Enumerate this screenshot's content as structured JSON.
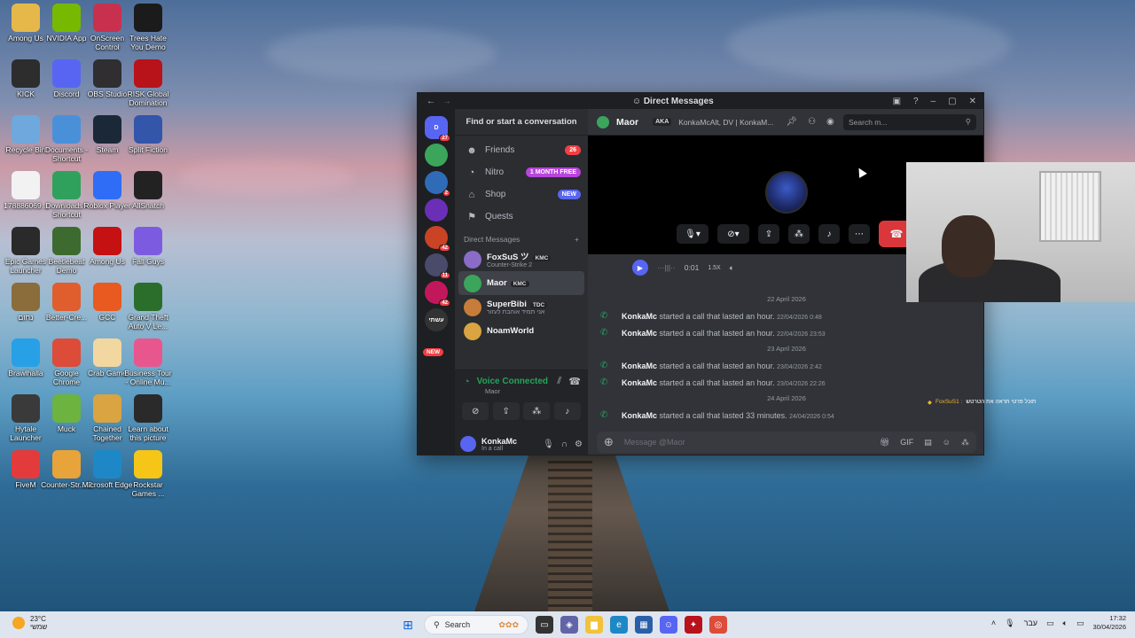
{
  "desktop": {
    "icons": [
      {
        "label": "Among Us",
        "icon": "among-us-icon",
        "color": "#e6b84a"
      },
      {
        "label": "NVIDIA App",
        "icon": "nvidia-icon",
        "color": "#76b900"
      },
      {
        "label": "OnScreen Control",
        "icon": "onscreen-control-icon",
        "color": "#c8314e"
      },
      {
        "label": "Trees Hate You Demo",
        "icon": "trees-hate-you-icon",
        "color": "#1b1b1b"
      },
      {
        "label": "KICK",
        "icon": "kick-icon",
        "color": "#2d2d2d"
      },
      {
        "label": "Discord",
        "icon": "discord-icon",
        "color": "#5865f2"
      },
      {
        "label": "OBS Studio",
        "icon": "obs-icon",
        "color": "#302e31"
      },
      {
        "label": "RISK Global Domination",
        "icon": "risk-icon",
        "color": "#b8121b"
      },
      {
        "label": "Recycle Bin",
        "icon": "recycle-bin-icon",
        "color": "#6fa8dc"
      },
      {
        "label": "Documents - Shortcut",
        "icon": "folder-icon",
        "color": "#4a90d9"
      },
      {
        "label": "Steam",
        "icon": "steam-icon",
        "color": "#1b2838"
      },
      {
        "label": "Split Fiction",
        "icon": "split-fiction-icon",
        "color": "#3355aa"
      },
      {
        "label": "178886069...",
        "icon": "file-icon",
        "color": "#f2f2f2"
      },
      {
        "label": "Downloads - Shortcut",
        "icon": "downloads-icon",
        "color": "#2fa15c"
      },
      {
        "label": "Roblox Player",
        "icon": "roblox-icon",
        "color": "#2f6df6"
      },
      {
        "label": "AllSnatch",
        "icon": "allsnatch-icon",
        "color": "#222222"
      },
      {
        "label": "Epic Games Launcher",
        "icon": "epic-games-icon",
        "color": "#2a2a2a"
      },
      {
        "label": "Beetlebeat Demo",
        "icon": "beetlebeat-icon",
        "color": "#3d6b2f"
      },
      {
        "label": "Among Us",
        "icon": "among-us-icon",
        "color": "#c51111"
      },
      {
        "label": "Fall Guys",
        "icon": "fall-guys-icon",
        "color": "#7d5be0"
      },
      {
        "label": "נחום",
        "icon": "game-icon",
        "color": "#8a6d3b"
      },
      {
        "label": "Better-Cre...",
        "icon": "better-crewlink-icon",
        "color": "#e05d2d"
      },
      {
        "label": "GCC",
        "icon": "gcc-icon",
        "color": "#e85a1f"
      },
      {
        "label": "Grand Theft Auto V Le...",
        "icon": "gta-icon",
        "color": "#2b6e2b"
      },
      {
        "label": "Brawlhalla",
        "icon": "brawlhalla-icon",
        "color": "#27a0e6"
      },
      {
        "label": "Google Chrome",
        "icon": "chrome-icon",
        "color": "#dd4b39"
      },
      {
        "label": "Crab Game",
        "icon": "crab-game-icon",
        "color": "#f2d7a0"
      },
      {
        "label": "Business Tour - Online Mu...",
        "icon": "business-tour-icon",
        "color": "#e8568e"
      },
      {
        "label": "Hytale Launcher",
        "icon": "hytale-icon",
        "color": "#3a3a3a"
      },
      {
        "label": "Muck",
        "icon": "muck-icon",
        "color": "#6cb33f"
      },
      {
        "label": "Chained Together",
        "icon": "chained-together-icon",
        "color": "#d9a441"
      },
      {
        "label": "Learn about this picture",
        "icon": "camera-icon",
        "color": "#2a2a2a"
      },
      {
        "label": "FiveM",
        "icon": "fivem-icon",
        "color": "#e33b3b"
      },
      {
        "label": "Counter-Str... 2",
        "icon": "cs2-icon",
        "color": "#e8a33a"
      },
      {
        "label": "Microsoft Edge",
        "icon": "edge-icon",
        "color": "#1e88c6"
      },
      {
        "label": "Rockstar Games ...",
        "icon": "rockstar-icon",
        "color": "#f5c518"
      }
    ]
  },
  "discord": {
    "window_title": "Direct Messages",
    "servers": [
      {
        "badge": "27",
        "color": "#5865f2",
        "text": "D"
      },
      {
        "badge": "",
        "color": "#3ba55c",
        "text": ""
      },
      {
        "badge": "2",
        "color": "#2f6bb7",
        "text": ""
      },
      {
        "badge": "",
        "color": "#6b2fb7",
        "text": ""
      },
      {
        "badge": "42",
        "color": "#c94324",
        "text": ""
      },
      {
        "badge": "11",
        "color": "#4a4a6a",
        "text": ""
      },
      {
        "badge": "42",
        "color": "#c2185b",
        "text": ""
      },
      {
        "badge": "",
        "color": "#333333",
        "text": "עשתי"
      }
    ],
    "server_new_label": "NEW",
    "find_label": "Find or start a conversation",
    "nav": [
      {
        "label": "Friends",
        "icon": "friends-icon",
        "pill": "26",
        "pill_color": "#f23f43"
      },
      {
        "label": "Nitro",
        "icon": "nitro-icon",
        "pill": "1 MONTH FREE",
        "pill_color": "#b845dc"
      },
      {
        "label": "Shop",
        "icon": "shop-icon",
        "pill": "NEW",
        "pill_color": "#5865f2"
      },
      {
        "label": "Quests",
        "icon": "quests-icon",
        "pill": "",
        "pill_color": ""
      }
    ],
    "dm_header": "Direct Messages",
    "dms": [
      {
        "name": "FoxSuS ツ",
        "tag": "KMC",
        "sub": "Counter-Strike 2",
        "color": "#8a6cc7"
      },
      {
        "name": "Maor",
        "tag": "KMC",
        "sub": "",
        "color": "#3ba55c"
      },
      {
        "name": "SuperBibi",
        "tag": "TDC",
        "sub": "אני תמיד אוהבת לעזור",
        "color": "#c77c3a"
      },
      {
        "name": "NoamWorld",
        "tag": "",
        "sub": "",
        "color": "#d9a441"
      }
    ],
    "voice": {
      "status": "Voice Connected",
      "channel": "Maor"
    },
    "user": {
      "name": "KonkaMc",
      "status": "In a call"
    },
    "chat": {
      "name": "Maor",
      "aka_label": "AKA",
      "aka_value": "KonkaMcAlt, DV | KonkaM...",
      "search_placeholder": "Search m...",
      "voice_message": {
        "time": "0:01",
        "speed": "1.5X"
      },
      "entries": [
        {
          "type": "date",
          "text": "22 April 2026"
        },
        {
          "type": "call",
          "who": "KonkaMc",
          "what": "started a call that lasted an hour.",
          "when": "22/04/2026 0:48"
        },
        {
          "type": "call",
          "who": "KonkaMc",
          "what": "started a call that lasted an hour.",
          "when": "22/04/2026 23:53"
        },
        {
          "type": "date",
          "text": "23 April 2026"
        },
        {
          "type": "call",
          "who": "KonkaMc",
          "what": "started a call that lasted an hour.",
          "when": "23/04/2026 2:42"
        },
        {
          "type": "call",
          "who": "KonkaMc",
          "what": "started a call that lasted an hour.",
          "when": "23/04/2026 22:26"
        },
        {
          "type": "date",
          "text": "24 April 2026"
        },
        {
          "type": "call",
          "who": "KonkaMc",
          "what": "started a call that lasted 33 minutes.",
          "when": "24/04/2026 0:54"
        }
      ],
      "composer_placeholder": "Message @Maor"
    }
  },
  "overlay": {
    "user": "FoxSuS1 :",
    "text": "תוכל פרטי תראה את הטרטש"
  },
  "taskbar": {
    "weather_temp": "23°C",
    "weather_desc": "שמשי",
    "search_label": "Search",
    "lang": "עבר",
    "time": "17:32",
    "date": "30/04/2026"
  }
}
